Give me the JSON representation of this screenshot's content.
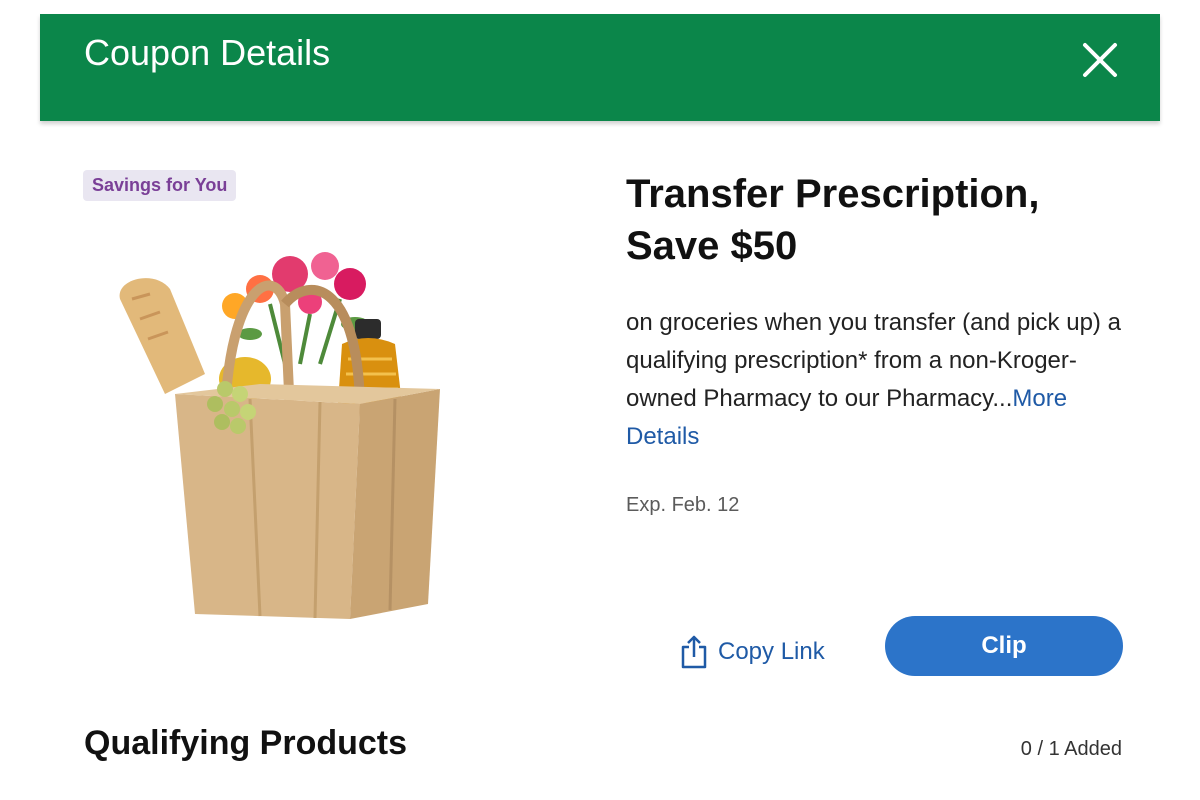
{
  "header": {
    "title": "Coupon Details",
    "close_icon": "close-icon",
    "background_color": "#0b864a"
  },
  "coupon": {
    "badge": "Savings for You",
    "image_icon": "grocery-bag-image",
    "title": "Transfer Prescription, Save $50",
    "description": "on groceries when you transfer (and pick up) a qualifying prescription* from a non-Kroger-owned Pharmacy to our Pharmacy...",
    "more_link": "More Details",
    "expiration": "Exp. Feb. 12"
  },
  "actions": {
    "copy_link_label": "Copy Link",
    "copy_link_icon": "share-icon",
    "clip_label": "Clip",
    "accent_color": "#2c74c9"
  },
  "qualifying_products": {
    "title": "Qualifying Products",
    "count": "0 / 1 Added"
  }
}
